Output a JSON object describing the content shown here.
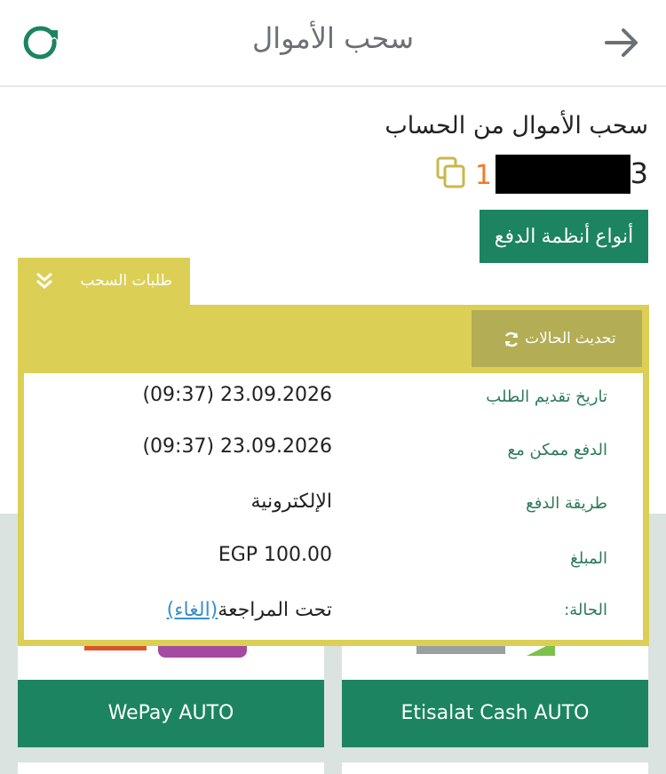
{
  "header": {
    "title": "سحب الأموال"
  },
  "account": {
    "title": "سحب الأموال من الحساب",
    "number_lead": "1",
    "number_tail": "3"
  },
  "buttons": {
    "payment_types": "أنواع أنظمة الدفع",
    "update_statuses": "تحديث الحالات"
  },
  "requests_tab": {
    "label": "طلبات السحب"
  },
  "request": {
    "rows": [
      {
        "label": "تاريخ تقديم الطلب",
        "value": "23.09.2026 (09:37)"
      },
      {
        "label": "الدفع ممكن مع",
        "value": "23.09.2026 (09:37)"
      },
      {
        "label": "طريقة الدفع",
        "value": "الإلكترونية"
      },
      {
        "label": "المبلغ",
        "value": "EGP 100.00"
      },
      {
        "label": "الحالة:",
        "value": "تحت المراجعة",
        "link": "(الغاء)"
      }
    ]
  },
  "methods": [
    {
      "label": "WePay AUTO"
    },
    {
      "label": "Etisalat Cash AUTO"
    }
  ],
  "colors": {
    "primary_green": "#1c8460",
    "panel_yellow": "#dccf55",
    "update_button": "#b3ad55",
    "label_green": "#2c7a5a",
    "link_blue": "#3a8ecf",
    "account_lead_orange": "#f07a2a"
  },
  "icons": {
    "refresh": "refresh-icon",
    "back": "arrow-right-icon",
    "copy": "copy-icon",
    "collapse": "double-chevron-down-icon",
    "sync": "sync-icon"
  }
}
